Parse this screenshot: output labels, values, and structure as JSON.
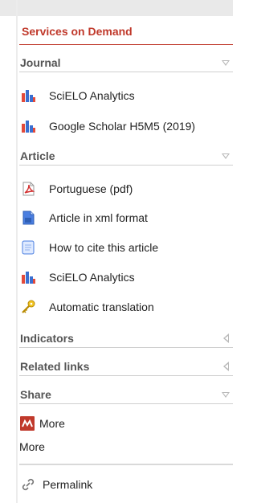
{
  "panel": {
    "title": "Services on Demand"
  },
  "sections": {
    "journal": {
      "label": "Journal",
      "state": "expanded"
    },
    "article": {
      "label": "Article",
      "state": "expanded"
    },
    "indicators": {
      "label": "Indicators",
      "state": "collapsed"
    },
    "related": {
      "label": "Related links",
      "state": "collapsed"
    },
    "share": {
      "label": "Share",
      "state": "expanded"
    }
  },
  "journal_items": [
    {
      "label": "SciELO Analytics",
      "icon": "bar-chart-icon"
    },
    {
      "label": "Google Scholar H5M5 (2019)",
      "icon": "bar-chart-icon"
    }
  ],
  "article_items": [
    {
      "label": "Portuguese (pdf)",
      "icon": "pdf-icon"
    },
    {
      "label": "Article in xml format",
      "icon": "xml-file-icon"
    },
    {
      "label": "How to cite this article",
      "icon": "document-icon"
    },
    {
      "label": "SciELO Analytics",
      "icon": "bar-chart-icon"
    },
    {
      "label": "Automatic translation",
      "icon": "key-icon"
    }
  ],
  "share": {
    "more_button": "More",
    "more_link": "More"
  },
  "permalink": {
    "label": "Permalink",
    "icon": "chain-link-icon"
  },
  "colors": {
    "accent": "#c0392b",
    "section_text": "#555555",
    "rule": "#cfcfcf",
    "share_badge": "#c0392b"
  }
}
